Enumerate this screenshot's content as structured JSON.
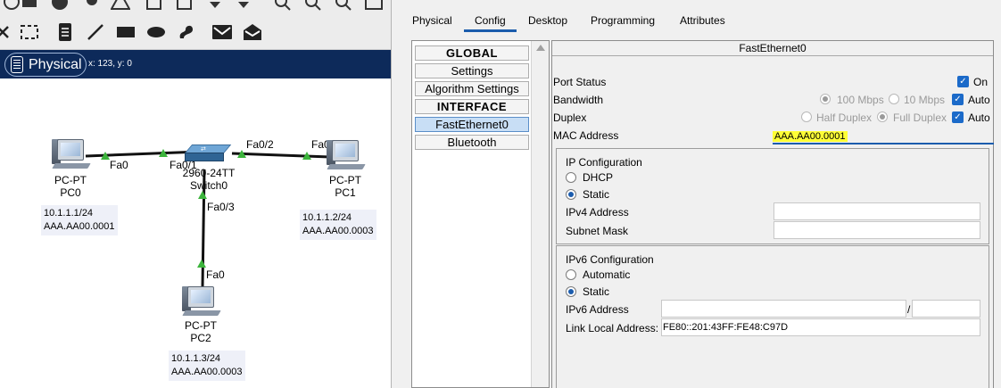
{
  "workspace": {
    "mode_label": "Physical",
    "coords": "x: 123, y: 0",
    "links": {
      "pc0_port": "Fa0",
      "sw_port_fa01": "Fa0/1",
      "sw_port_fa02": "Fa0/2",
      "pc1_port": "Fa0",
      "sw_port_fa03": "Fa0/3",
      "pc2_port": "Fa0"
    },
    "devices": {
      "pc0": {
        "type": "PC-PT",
        "name": "PC0",
        "ip": "10.1.1.1/24",
        "mac": "AAA.AA00.0001"
      },
      "pc1": {
        "type": "PC-PT",
        "name": "PC1",
        "ip": "10.1.1.2/24",
        "mac": "AAA.AA00.0003"
      },
      "pc2": {
        "type": "PC-PT",
        "name": "PC2",
        "ip": "10.1.1.3/24",
        "mac": "AAA.AA00.0003"
      },
      "switch0": {
        "type": "2960-24TT",
        "name": "Switch0"
      }
    }
  },
  "dialog": {
    "tabs": [
      "Physical",
      "Config",
      "Desktop",
      "Programming",
      "Attributes"
    ],
    "active_tab": "Config",
    "sidebar": [
      "GLOBAL",
      "Settings",
      "Algorithm Settings",
      "INTERFACE",
      "FastEthernet0",
      "Bluetooth"
    ],
    "panel_title": "FastEthernet0",
    "port_status": {
      "label": "Port Status",
      "on_label": "On"
    },
    "bandwidth": {
      "label": "Bandwidth",
      "opt1": "100 Mbps",
      "opt2": "10 Mbps",
      "auto": "Auto"
    },
    "duplex": {
      "label": "Duplex",
      "opt1": "Half Duplex",
      "opt2": "Full Duplex",
      "auto": "Auto"
    },
    "mac": {
      "label": "MAC Address",
      "value": "AAA.AA00.0001"
    },
    "ipv4": {
      "title": "IP Configuration",
      "dhcp": "DHCP",
      "static": "Static",
      "address_label": "IPv4 Address",
      "mask_label": "Subnet Mask"
    },
    "ipv6": {
      "title": "IPv6 Configuration",
      "automatic": "Automatic",
      "static": "Static",
      "address_label": "IPv6 Address",
      "slash": "/",
      "link_local_label": "Link Local Address:",
      "link_local_value": "FE80::201:43FF:FE48:C97D"
    }
  }
}
